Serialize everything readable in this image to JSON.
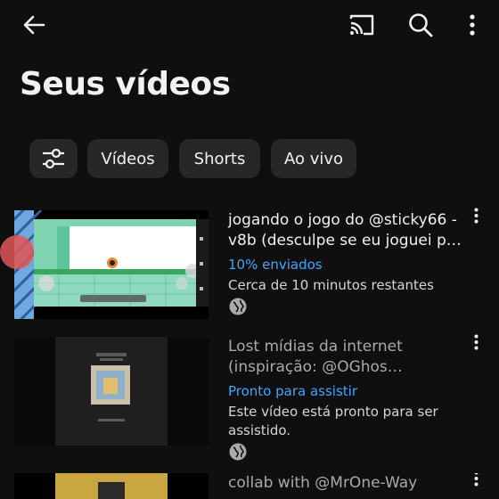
{
  "header": {
    "back_icon": "arrow-back-icon",
    "cast_icon": "cast-icon",
    "search_icon": "search-icon",
    "more_icon": "more-vertical-icon"
  },
  "page": {
    "title": "Seus vídeos"
  },
  "filters": {
    "settings_icon": "filter-settings-icon",
    "chips": [
      "Vídeos",
      "Shorts",
      "Ao vivo"
    ]
  },
  "videos": [
    {
      "title": "jogando o jogo do @sticky66 -v8b (desculpe se eu joguei p…",
      "status": "10% enviados",
      "sub": "Cerca de 10 minutos restantes",
      "visibility_icon": "globe-icon"
    },
    {
      "title": "Lost mídias da internet (inspiração: @OGhos…",
      "status": "Pronto para assistir",
      "sub": "Este vídeo está pronto para ser assistido.",
      "visibility_icon": "globe-icon"
    },
    {
      "title": "collab with @MrOne-Way"
    }
  ],
  "colors": {
    "background": "#0f0f0f",
    "chip": "#272727",
    "accent": "#3ea6ff"
  }
}
